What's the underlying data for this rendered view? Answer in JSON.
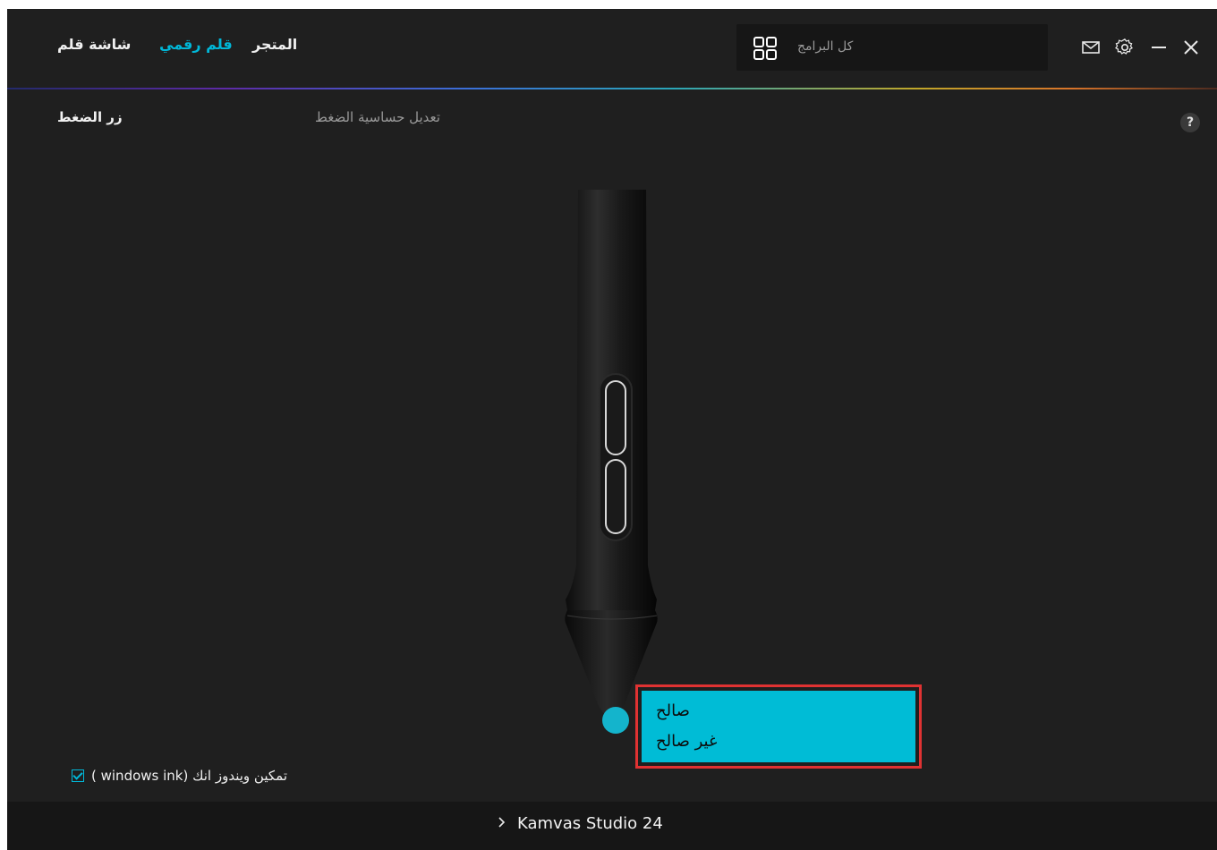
{
  "header": {
    "tabs": [
      {
        "label": "شاشة قلم",
        "active": false
      },
      {
        "label": "قلم رقمي",
        "active": true
      },
      {
        "label": "المتجر",
        "active": false
      }
    ],
    "apps_selector": {
      "label": "كل البرامج",
      "icon": "apps-grid-icon"
    },
    "back_icon": "chevron-left-icon",
    "window_controls": [
      "close-icon",
      "minimize-icon",
      "settings-icon",
      "mail-icon"
    ]
  },
  "subtabs": {
    "press_button": "زر الضغط",
    "pressure_sensitivity": "تعديل حساسية الضغط",
    "help": "?"
  },
  "pen_tip_menu": {
    "options": [
      "صالح",
      "غير صالح"
    ]
  },
  "windows_ink": {
    "label": "( windows ink) تمكين ويندوز انك",
    "checked": true
  },
  "footer": {
    "device_name": "Kamvas Studio 24"
  },
  "colors": {
    "accent": "#00b8d9",
    "background": "#1f1f1f",
    "menu_bg": "#00bcd6",
    "highlight_border": "#e03232"
  }
}
